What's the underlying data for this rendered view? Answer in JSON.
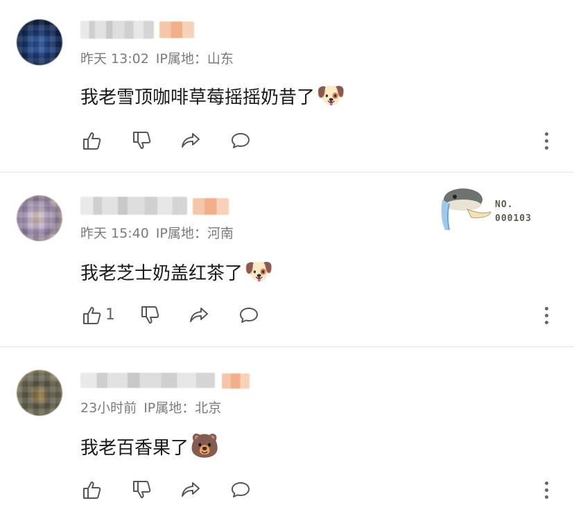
{
  "comments": [
    {
      "meta": {
        "time": "昨天 13:02",
        "ip_label": "IP属地：山东"
      },
      "text": "我老雪顶咖啡草莓摇摇奶昔了",
      "emoji": "🐶",
      "likes": "",
      "avatar": "avatar-blurred"
    },
    {
      "meta": {
        "time": "昨天 15:40",
        "ip_label": "IP属地：河南"
      },
      "text": "我老芝士奶盖红茶了",
      "emoji": "🐶",
      "likes": "1",
      "avatar": "avatar-blurred",
      "sticker": {
        "line1": "NO.",
        "line2": "000103"
      }
    },
    {
      "meta": {
        "time": "23小时前",
        "ip_label": "IP属地：北京"
      },
      "text": "我老百香果了",
      "emoji": "🐻",
      "likes": "",
      "avatar": "avatar-blurred"
    }
  ],
  "icons": {
    "like": "thumbs-up-icon",
    "dislike": "thumbs-down-icon",
    "share": "share-icon",
    "reply": "comment-icon",
    "more": "more-vertical-icon"
  },
  "colors": {
    "text": "#1a1a1a",
    "meta": "#7a7a7a",
    "icon": "#555555",
    "divider": "#e4e4e4"
  }
}
